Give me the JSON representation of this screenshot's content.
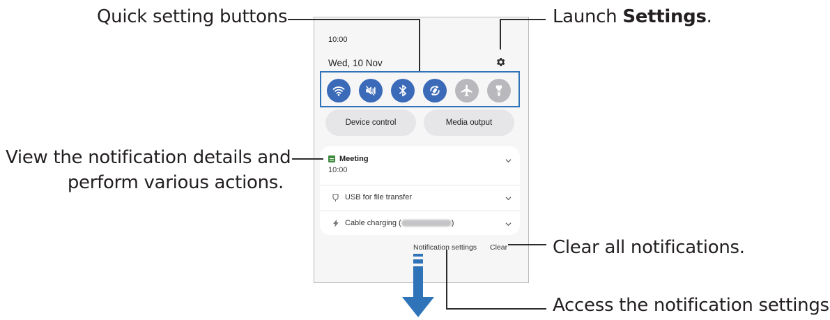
{
  "callouts": {
    "quick_settings": "Quick setting buttons",
    "launch_prefix": "Launch ",
    "launch_bold": "Settings",
    "launch_suffix": ".",
    "notification_line1": "View the notification details and",
    "notification_line2": "perform various actions.",
    "clear_all": "Clear all notifications.",
    "access_settings": "Access the notification settings."
  },
  "phone": {
    "time": "10:00",
    "date": "Wed, 10 Nov",
    "quick_settings": [
      {
        "icon": "wifi-icon",
        "state": "on"
      },
      {
        "icon": "mute-icon",
        "state": "on"
      },
      {
        "icon": "bluetooth-icon",
        "state": "on"
      },
      {
        "icon": "auto-rotate-icon",
        "state": "on"
      },
      {
        "icon": "airplane-icon",
        "state": "off"
      },
      {
        "icon": "flashlight-icon",
        "state": "off"
      }
    ],
    "device_control": "Device control",
    "media_output": "Media output",
    "notifications": {
      "meeting_title": "Meeting",
      "meeting_time": "10:00",
      "usb": "USB for file transfer",
      "cable_charging": "Cable charging (",
      "cable_charging_close": ")"
    },
    "footer": {
      "notification_settings": "Notification settings",
      "clear": "Clear"
    }
  },
  "colors": {
    "accent_blue": "#2f74b8",
    "tile_on": "#3a6ab8",
    "tile_off": "#b9b9bd",
    "arrow": "#2f74b8"
  }
}
